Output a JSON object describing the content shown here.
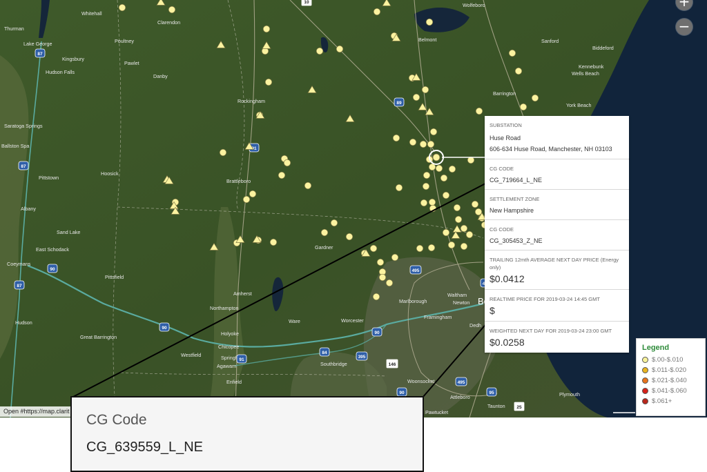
{
  "map": {
    "zoom_in_label": "+",
    "zoom_out_label": "−",
    "open_link": "Open #https://map.clarit",
    "places": [
      {
        "label": "Whitehall",
        "color": "#e8e8e8"
      },
      {
        "label": "Poultney",
        "color": "#e8e8e8"
      },
      {
        "label": "Clarendon",
        "color": "#e8e8e8"
      },
      {
        "label": "Thurman",
        "color": "#e8e8e8"
      },
      {
        "label": "Lake George",
        "color": "#e8e8e8"
      },
      {
        "label": "Kingsbury",
        "color": "#e8e8e8"
      },
      {
        "label": "Hudson Falls",
        "color": "#e8e8e8"
      },
      {
        "label": "Pawlet",
        "color": "#e8e8e8"
      },
      {
        "label": "Danby",
        "color": "#e8e8e8"
      },
      {
        "label": "Rockingham",
        "color": "#e8e8e8"
      },
      {
        "label": "Saratoga Springs",
        "color": "#e8e8e8"
      },
      {
        "label": "Ballston Spa",
        "color": "#e8e8e8"
      },
      {
        "label": "Pittstown",
        "color": "#e8e8e8"
      },
      {
        "label": "Hoosick",
        "color": "#e8e8e8"
      },
      {
        "label": "Brattleboro",
        "color": "#e8e8e8"
      },
      {
        "label": "Albany",
        "color": "#e8e8e8"
      },
      {
        "label": "Sand Lake",
        "color": "#e8e8e8"
      },
      {
        "label": "East Schodack",
        "color": "#e8e8e8"
      },
      {
        "label": "Coeymans",
        "color": "#e8e8e8"
      },
      {
        "label": "Pittsfield",
        "color": "#e8e8e8"
      },
      {
        "label": "Amherst",
        "color": "#e8e8e8"
      },
      {
        "label": "Northampton",
        "color": "#e8e8e8"
      },
      {
        "label": "Holyoke",
        "color": "#e8e8e8"
      },
      {
        "label": "Hudson",
        "color": "#e8e8e8"
      },
      {
        "label": "Great Barrington",
        "color": "#e8e8e8"
      },
      {
        "label": "Westfield",
        "color": "#e8e8e8"
      },
      {
        "label": "Chicopee",
        "color": "#e8e8e8"
      },
      {
        "label": "Springfield",
        "color": "#e8e8e8"
      },
      {
        "label": "Agawam",
        "color": "#e8e8e8"
      },
      {
        "label": "Enfield",
        "color": "#e8e8e8"
      },
      {
        "label": "Gardner",
        "color": "#e8e8e8"
      },
      {
        "label": "Ware",
        "color": "#e8e8e8"
      },
      {
        "label": "Worcester",
        "color": "#e8e8e8"
      },
      {
        "label": "Southbridge",
        "color": "#e8e8e8"
      },
      {
        "label": "Marlborough",
        "color": "#e8e8e8"
      },
      {
        "label": "Framingham",
        "color": "#e8e8e8"
      },
      {
        "label": "Waltham",
        "color": "#e8e8e8"
      },
      {
        "label": "Newton",
        "color": "#e8e8e8"
      },
      {
        "label": "Bo",
        "color": "#ffffff"
      },
      {
        "label": "Dedh",
        "color": "#e8e8e8"
      },
      {
        "label": "Woonsocket",
        "color": "#e8e8e8"
      },
      {
        "label": "Attleboro",
        "color": "#e8e8e8"
      },
      {
        "label": "Taunton",
        "color": "#e8e8e8"
      },
      {
        "label": "Pawtucket",
        "color": "#e8e8e8"
      },
      {
        "label": "Plymouth",
        "color": "#e8e8e8"
      },
      {
        "label": "Wolfeboro",
        "color": "#e8e8e8"
      },
      {
        "label": "Belmont",
        "color": "#e8e8e8"
      },
      {
        "label": "Sanford",
        "color": "#e8e8e8"
      },
      {
        "label": "Biddeford",
        "color": "#e8e8e8"
      },
      {
        "label": "Kennebunk",
        "color": "#e8e8e8"
      },
      {
        "label": "Wells Beach",
        "color": "#e8e8e8"
      },
      {
        "label": "Barrington",
        "color": "#e8e8e8"
      },
      {
        "label": "York Beach",
        "color": "#e8e8e8"
      }
    ],
    "shields": [
      {
        "label": "87",
        "kind": "interstate"
      },
      {
        "label": "87",
        "kind": "interstate"
      },
      {
        "label": "87",
        "kind": "interstate"
      },
      {
        "label": "89",
        "kind": "interstate"
      },
      {
        "label": "91",
        "kind": "interstate"
      },
      {
        "label": "90",
        "kind": "interstate"
      },
      {
        "label": "90",
        "kind": "interstate"
      },
      {
        "label": "90",
        "kind": "interstate"
      },
      {
        "label": "90",
        "kind": "interstate"
      },
      {
        "label": "91",
        "kind": "interstate"
      },
      {
        "label": "84",
        "kind": "interstate"
      },
      {
        "label": "395",
        "kind": "interstate"
      },
      {
        "label": "495",
        "kind": "interstate"
      },
      {
        "label": "495",
        "kind": "interstate"
      },
      {
        "label": "95",
        "kind": "interstate"
      },
      {
        "label": "495",
        "kind": "interstate"
      },
      {
        "label": "146",
        "kind": "state"
      },
      {
        "label": "25",
        "kind": "state"
      },
      {
        "label": "10",
        "kind": "state"
      }
    ]
  },
  "popup": {
    "substation": {
      "heading": "SUBSTATION",
      "name": "Huse Road",
      "address": "606-634 Huse Road, Manchester, NH 03103"
    },
    "cg_code_1": {
      "heading": "CG CODE",
      "value": "CG_719664_L_NE"
    },
    "zone": {
      "heading": "SETTLEMENT ZONE",
      "value": "New Hampshire"
    },
    "cg_code_2": {
      "heading": "CG CODE",
      "value": "CG_305453_Z_NE"
    },
    "trailing": {
      "heading": "TRAILING 12mth AVERAGE NEXT DAY PRICE (Energy only)",
      "value": "$0.0412"
    },
    "realtime": {
      "heading": "REALTIME PRICE FOR 2019-03-24 14:45 GMT",
      "value": "$"
    },
    "weighted": {
      "heading": "WEIGHTED NEXT DAY FOR 2019-03-24 23:00 GMT",
      "value": "$0.0258"
    }
  },
  "legend": {
    "title": "Legend",
    "items": [
      {
        "label": "$.00-$.010",
        "color": "#f7f19b"
      },
      {
        "label": "$.011-$.020",
        "color": "#e9b422"
      },
      {
        "label": "$.021-$.040",
        "color": "#e8731d"
      },
      {
        "label": "$.041-$.060",
        "color": "#d6211a"
      },
      {
        "label": "$.061+",
        "color": "#b8261c"
      }
    ]
  },
  "bottom_card": {
    "title": "CG Code",
    "value": "CG_639559_L_NE"
  },
  "colors": {
    "marker_fill": "#fbf3a0",
    "marker_stroke": "#7a7440",
    "ocean": "#11243b",
    "forest": "#3b5527",
    "highway": "#5aaba0"
  }
}
